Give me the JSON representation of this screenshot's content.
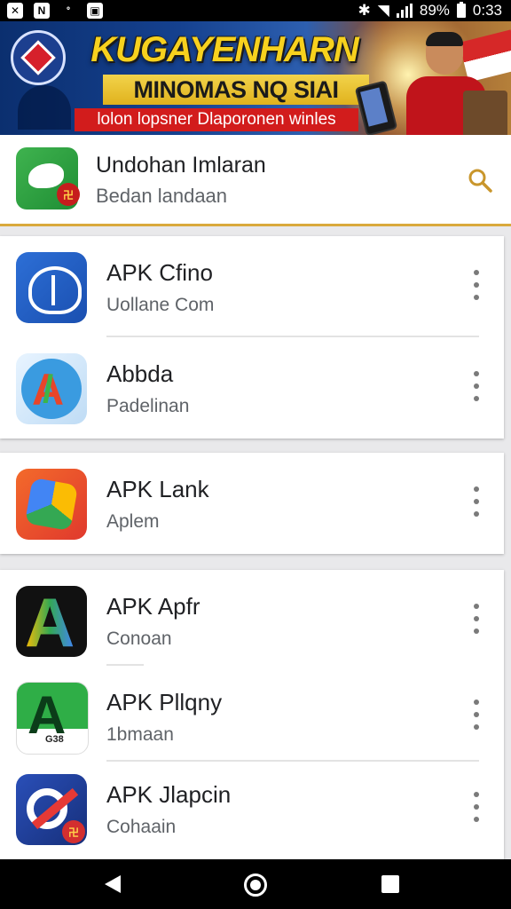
{
  "status_bar": {
    "battery_text": "89%",
    "time": "0:33"
  },
  "banner": {
    "title": "KUGAYENHARN",
    "subtitle": "MINOMAS NQ SIAI",
    "tagline": "lolon lopsner Dlaporonen winles"
  },
  "header": {
    "title": "Undohan Imlaran",
    "subtitle": "Bedan landaan",
    "search_icon": "search-icon"
  },
  "app_list": [
    {
      "name": "APK Cfino",
      "subtitle": "Uollane Com",
      "icon": "cloud-app-icon"
    },
    {
      "name": "Abbda",
      "subtitle": "Padelinan",
      "icon": "abbda-app-icon"
    },
    {
      "name": "APK Lank",
      "subtitle": "Aplem",
      "icon": "lank-app-icon"
    },
    {
      "name": "APK Apfr",
      "subtitle": "Conoan",
      "icon": "apfr-app-icon"
    },
    {
      "name": "APK Pllqny",
      "subtitle": "1bmaan",
      "icon": "pllqny-app-icon"
    },
    {
      "name": "APK Jlapcin",
      "subtitle": "Cohaain",
      "icon": "jlapcin-app-icon"
    }
  ],
  "icon_labels": {
    "header_badge": "卍",
    "play_text": "G38",
    "jlap_badge": "卍"
  },
  "colors": {
    "accent_gold": "#d9a93c",
    "banner_red": "#d21c1c",
    "banner_yellow": "#f7d11e"
  }
}
